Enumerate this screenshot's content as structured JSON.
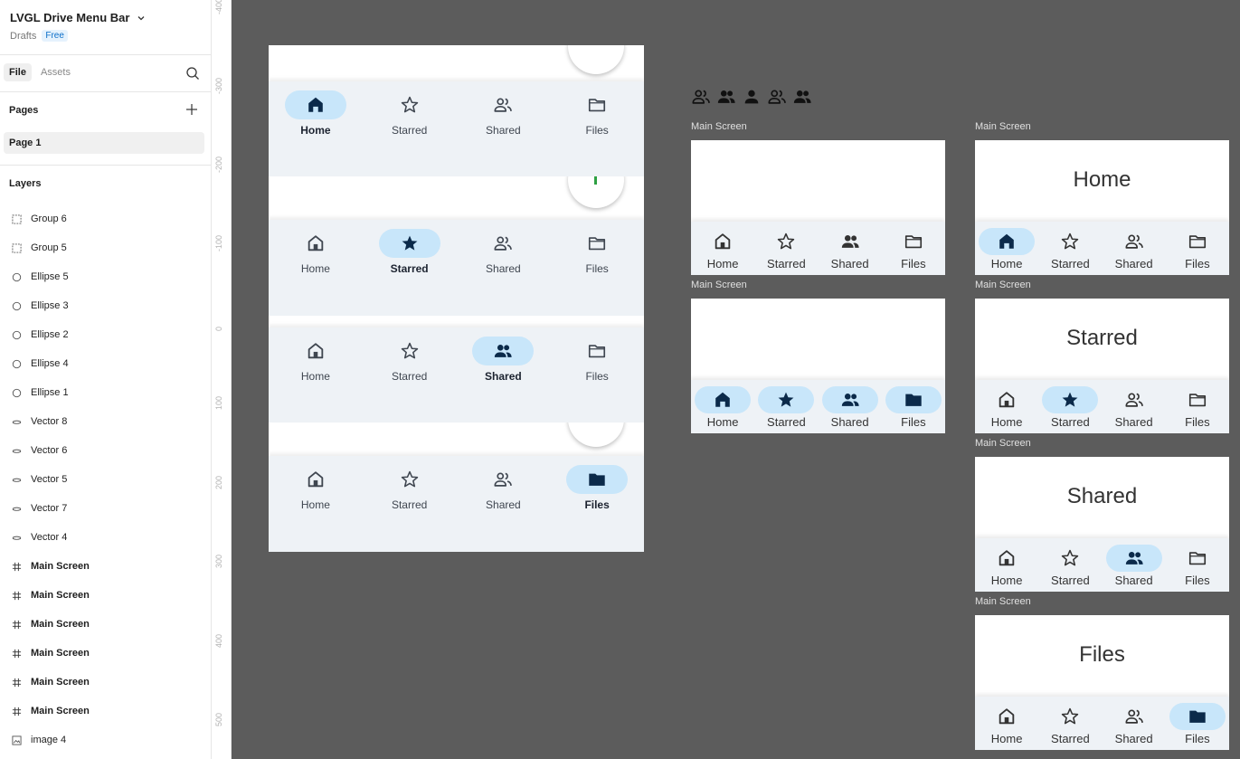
{
  "app": {
    "file_title": "LVGL Drive Menu Bar",
    "location": "Drafts",
    "plan_badge": "Free"
  },
  "sidebar": {
    "tabs": [
      "File",
      "Assets"
    ],
    "pages_title": "Pages",
    "pages": [
      "Page 1"
    ],
    "layers_title": "Layers",
    "layers": [
      {
        "name": "Group 6",
        "type": "group"
      },
      {
        "name": "Group 5",
        "type": "group"
      },
      {
        "name": "Ellipse 5",
        "type": "ellipse"
      },
      {
        "name": "Ellipse 3",
        "type": "ellipse"
      },
      {
        "name": "Ellipse 2",
        "type": "ellipse"
      },
      {
        "name": "Ellipse 4",
        "type": "ellipse"
      },
      {
        "name": "Ellipse 1",
        "type": "ellipse"
      },
      {
        "name": "Vector 8",
        "type": "vector"
      },
      {
        "name": "Vector 6",
        "type": "vector"
      },
      {
        "name": "Vector 5",
        "type": "vector"
      },
      {
        "name": "Vector 7",
        "type": "vector"
      },
      {
        "name": "Vector 4",
        "type": "vector"
      },
      {
        "name": "Main Screen",
        "type": "frame"
      },
      {
        "name": "Main Screen",
        "type": "frame"
      },
      {
        "name": "Main Screen",
        "type": "frame"
      },
      {
        "name": "Main Screen",
        "type": "frame"
      },
      {
        "name": "Main Screen",
        "type": "frame"
      },
      {
        "name": "Main Screen",
        "type": "frame"
      },
      {
        "name": "image 4",
        "type": "image"
      }
    ]
  },
  "ruler": [
    "-400",
    "-300",
    "-200",
    "-100",
    "0",
    "100",
    "200",
    "300",
    "400",
    "500"
  ],
  "nav_labels": [
    "Home",
    "Starred",
    "Shared",
    "Files"
  ],
  "big_frame_active": [
    0,
    1,
    2,
    3
  ],
  "frame_label": "Main Screen",
  "mini_frames": [
    {
      "heading": "",
      "active": [],
      "filled_all": false
    },
    {
      "heading": "",
      "active": [
        0,
        1,
        2,
        3
      ],
      "filled_all": true
    },
    {
      "heading": "Home",
      "active": [
        0
      ]
    },
    {
      "heading": "Starred",
      "active": [
        1
      ]
    },
    {
      "heading": "Shared",
      "active": [
        2
      ]
    },
    {
      "heading": "Files",
      "active": [
        3
      ]
    }
  ],
  "colors": {
    "canvas": "#5c5c5c",
    "pill_active": "#c8e6fa",
    "bar_bg": "#eef2f6",
    "icon_active": "#0b2a4a",
    "icon_inactive": "#3f4650",
    "accent_green": "#2ea043"
  }
}
